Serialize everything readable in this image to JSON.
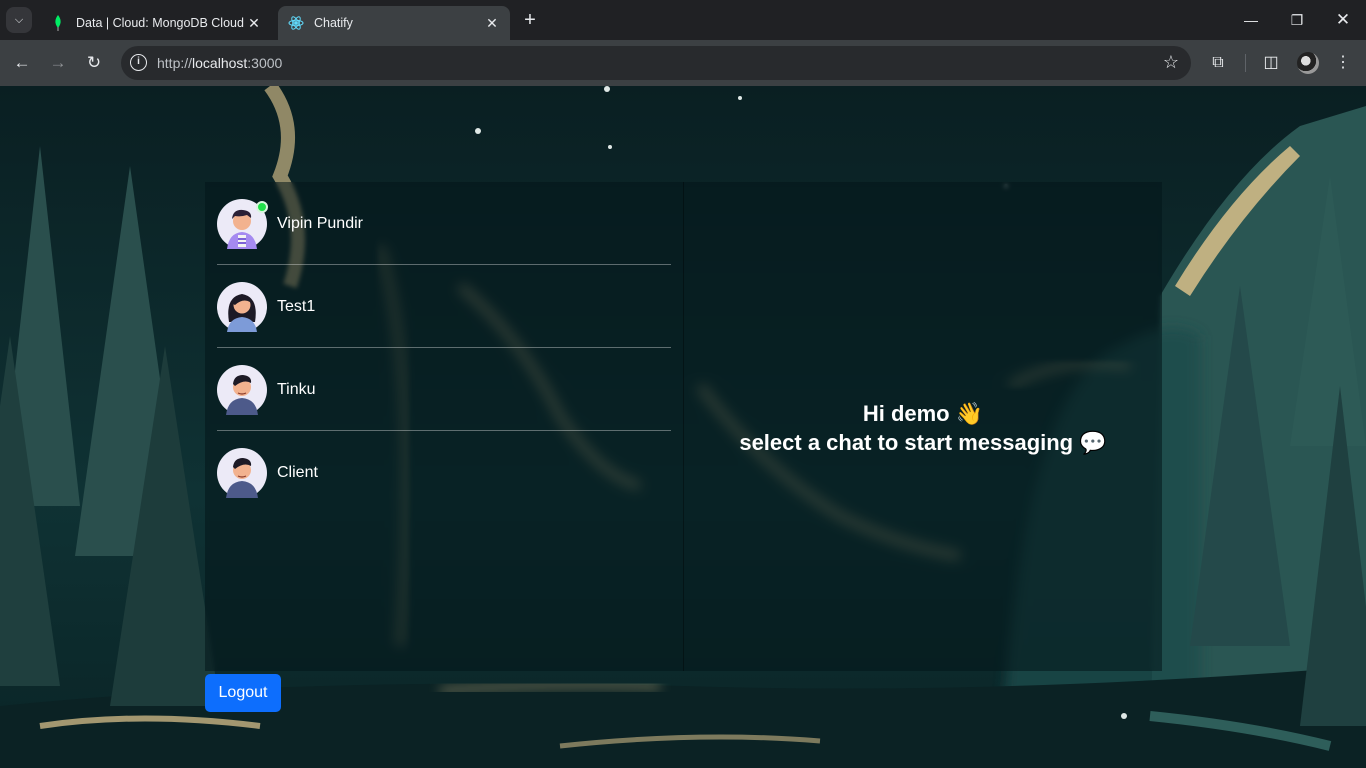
{
  "browser": {
    "tabs": [
      {
        "title": "Data | Cloud: MongoDB Cloud",
        "favicon": "mongodb-leaf-icon",
        "active": false
      },
      {
        "title": "Chatify",
        "favicon": "react-atom-icon",
        "active": true
      }
    ],
    "url_scheme": "http://",
    "url_host": "localhost",
    "url_rest": ":3000"
  },
  "sidebar": {
    "contacts": [
      {
        "name": "Vipin Pundir",
        "online": true
      },
      {
        "name": "Test1",
        "online": false
      },
      {
        "name": "Tinku",
        "online": false
      },
      {
        "name": "Client",
        "online": false
      }
    ]
  },
  "main": {
    "greeting": "Hi demo",
    "greeting_emoji": "👋",
    "prompt": "select a chat to start messaging",
    "prompt_emoji": "💬"
  },
  "logout_label": "Logout",
  "colors": {
    "logout_button": "#0d6efd",
    "online_dot": "#22e04a"
  }
}
